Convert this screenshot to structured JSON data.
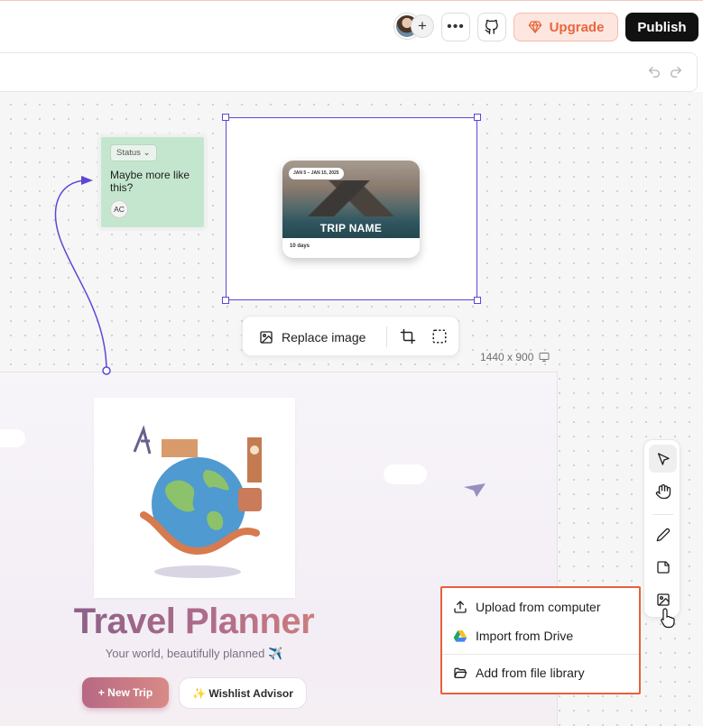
{
  "header": {
    "avatar_add_label": "+",
    "more_label": "•••",
    "upgrade_label": "Upgrade",
    "publish_label": "Publish"
  },
  "sticky_note": {
    "status_label": "Status",
    "text": "Maybe more like this?",
    "initials": "AC"
  },
  "trip_card": {
    "dates": "JAN 5 – JAN 15, 2025",
    "name": "TRIP NAME",
    "duration": "10 days"
  },
  "image_toolbar": {
    "replace_label": "Replace image"
  },
  "canvas": {
    "dimensions": "1440 x 900"
  },
  "app_preview": {
    "title": "Travel Planner",
    "subtitle": "Your world, beautifully planned ✈️",
    "new_trip_label": "+ New Trip",
    "wishlist_label": "✨ Wishlist Advisor"
  },
  "image_menu": {
    "items": [
      {
        "label": "Upload from computer",
        "icon": "upload-icon"
      },
      {
        "label": "Import from Drive",
        "icon": "google-drive-icon"
      },
      {
        "label": "Add from file library",
        "icon": "folder-open-icon"
      }
    ]
  },
  "colors": {
    "accent": "#5b48d6",
    "upgrade": "#e8673f",
    "menu_highlight": "#e8603a",
    "sticky": "#c4e6cf"
  }
}
